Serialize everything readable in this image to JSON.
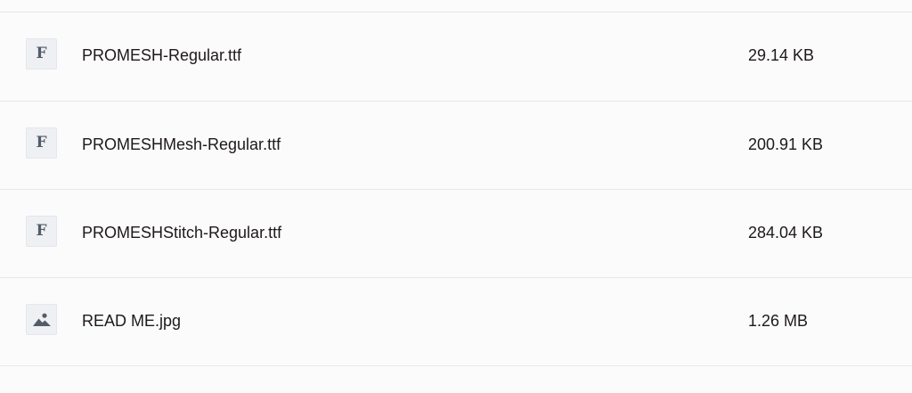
{
  "files": [
    {
      "name": "PROMESH-Regular.ttf",
      "size": "29.14 KB",
      "icon": "font-file-icon",
      "glyph": "F"
    },
    {
      "name": "PROMESHMesh-Regular.ttf",
      "size": "200.91 KB",
      "icon": "font-file-icon",
      "glyph": "F"
    },
    {
      "name": "PROMESHStitch-Regular.ttf",
      "size": "284.04 KB",
      "icon": "font-file-icon",
      "glyph": "F"
    },
    {
      "name": "READ ME.jpg",
      "size": "1.26 MB",
      "icon": "image-file-icon"
    }
  ],
  "colors": {
    "background": "#fbfbfc",
    "divider": "#e6e8eb",
    "text": "#1e1919",
    "icon": "#525c69"
  }
}
